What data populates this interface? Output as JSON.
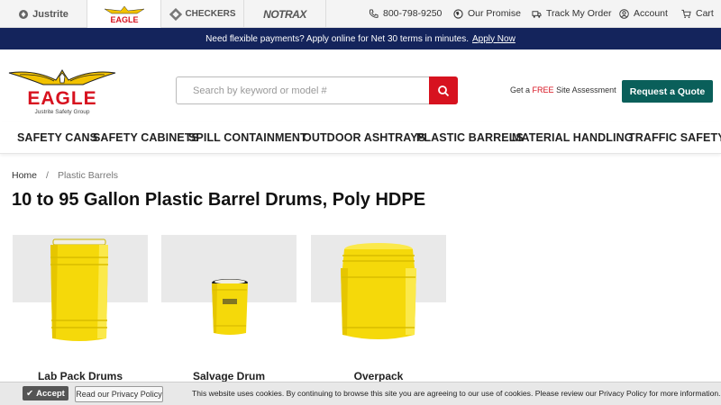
{
  "brands": [
    {
      "name": "Justrite",
      "active": false
    },
    {
      "name": "EAGLE",
      "active": true
    },
    {
      "name": "CHECKERS",
      "active": false
    },
    {
      "name": "NOTRAX",
      "active": false
    }
  ],
  "top_links": {
    "phone": "800-798-9250",
    "promise": "Our Promise",
    "track": "Track My Order",
    "account": "Account",
    "cart": "Cart"
  },
  "promo": {
    "text": "Need flexible payments? Apply online for Net 30 terms in minutes.",
    "link": "Apply Now"
  },
  "logo": {
    "name": "EAGLE",
    "tagline": "Justrite Safety Group"
  },
  "search": {
    "placeholder": "Search by keyword or model #",
    "value": ""
  },
  "assessment": {
    "prefix": "Get a",
    "free": "FREE",
    "suffix": "Site Assessment"
  },
  "quote_button": "Request a Quote",
  "nav": [
    "SAFETY CANS",
    "SAFETY CABINETS",
    "SPILL CONTAINMENT",
    "OUTDOOR ASHTRAYS",
    "PLASTIC BARRELS",
    "MATERIAL HANDLING",
    "TRAFFIC SAFETY"
  ],
  "breadcrumb": {
    "home": "Home",
    "separator": "/",
    "current": "Plastic Barrels"
  },
  "page_title": "10 to 95 Gallon Plastic Barrel Drums, Poly HDPE",
  "products": [
    {
      "title": "Lab Pack Drums",
      "icon": "lab-pack-drum"
    },
    {
      "title": "Salvage Drum",
      "icon": "salvage-drum"
    },
    {
      "title": "Overpack",
      "icon": "overpack-drum"
    }
  ],
  "cookie": {
    "accept": "Accept",
    "privacy": "Read our Privacy Policy",
    "text": "This website uses cookies. By continuing to browse this site you are agreeing to our use of cookies. Please review our Privacy Policy for more information."
  },
  "colors": {
    "promo_bg": "#14245c",
    "brand_red": "#d7121f",
    "quote_green": "#0a5f5a",
    "drum_yellow": "#f5d90a"
  }
}
